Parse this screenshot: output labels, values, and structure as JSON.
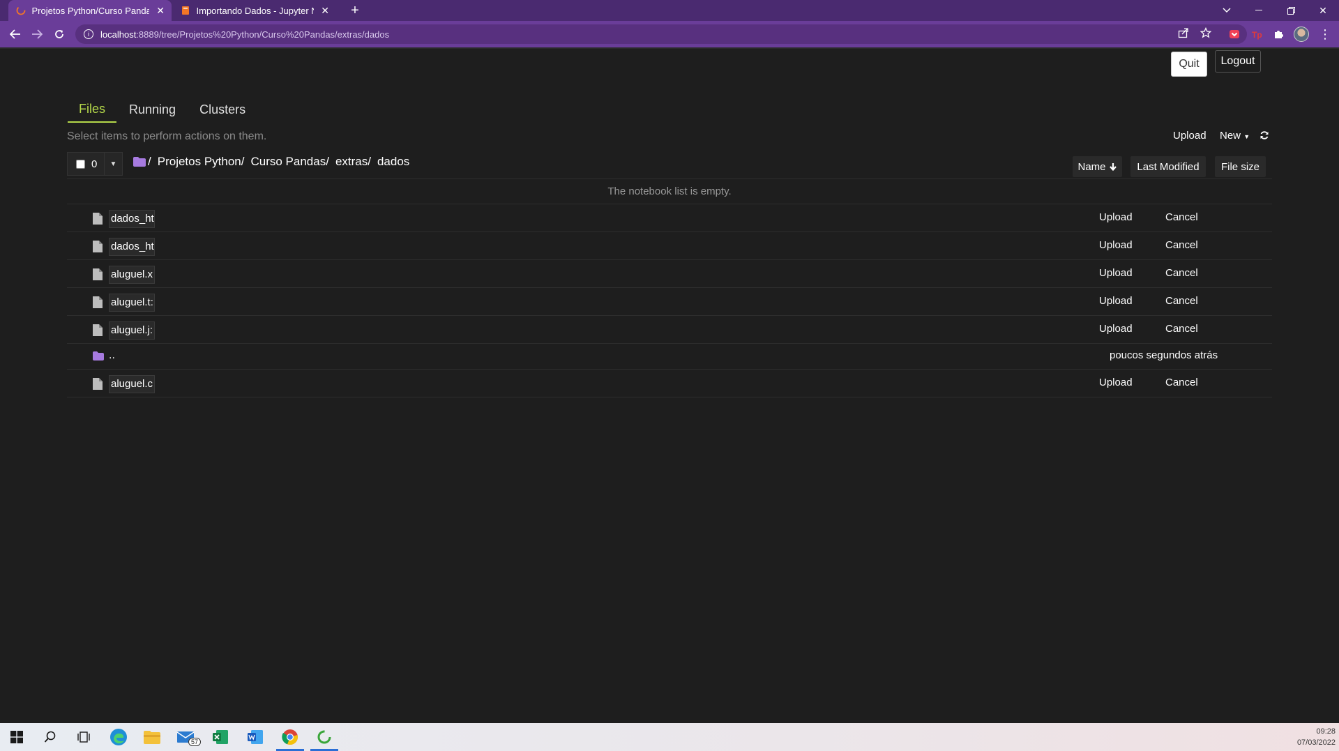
{
  "browser": {
    "tabs": [
      {
        "title": "Projetos Python/Curso Pandas/e",
        "active": true
      },
      {
        "title": "Importando Dados - Jupyter Not",
        "active": false
      }
    ],
    "url_host": "localhost",
    "url_path": ":8889/tree/Projetos%20Python/Curso%20Pandas/extras/dados"
  },
  "header": {
    "quit_label": "Quit",
    "logout_label": "Logout"
  },
  "tabs": {
    "files": "Files",
    "running": "Running",
    "clusters": "Clusters"
  },
  "toolbar": {
    "hint": "Select items to perform actions on them.",
    "upload_label": "Upload",
    "new_label": "New",
    "selected_count": "0"
  },
  "breadcrumb": [
    "Projetos Python/",
    "Curso Pandas/",
    "extras/",
    "dados"
  ],
  "sort": {
    "name": "Name",
    "last_modified": "Last Modified",
    "file_size": "File size"
  },
  "empty_message": "The notebook list is empty.",
  "rows": [
    {
      "name": "dados_ht",
      "upload": "Upload",
      "cancel": "Cancel"
    },
    {
      "name": "dados_ht",
      "upload": "Upload",
      "cancel": "Cancel"
    },
    {
      "name": "aluguel.x",
      "upload": "Upload",
      "cancel": "Cancel"
    },
    {
      "name": "aluguel.t:",
      "upload": "Upload",
      "cancel": "Cancel"
    },
    {
      "name": "aluguel.j:",
      "upload": "Upload",
      "cancel": "Cancel"
    }
  ],
  "parent_dir": {
    "name": "..",
    "modified": "poucos segundos atrás"
  },
  "last_row": {
    "name": "aluguel.c",
    "upload": "Upload",
    "cancel": "Cancel"
  },
  "taskbar": {
    "mail_badge": "57",
    "time": "09:28",
    "date": "07/03/2022"
  },
  "colors": {
    "accent": "#b5d94a",
    "chrome_bg": "#6a3d99",
    "page_bg": "#1e1e1e",
    "folder": "#a77be0"
  }
}
